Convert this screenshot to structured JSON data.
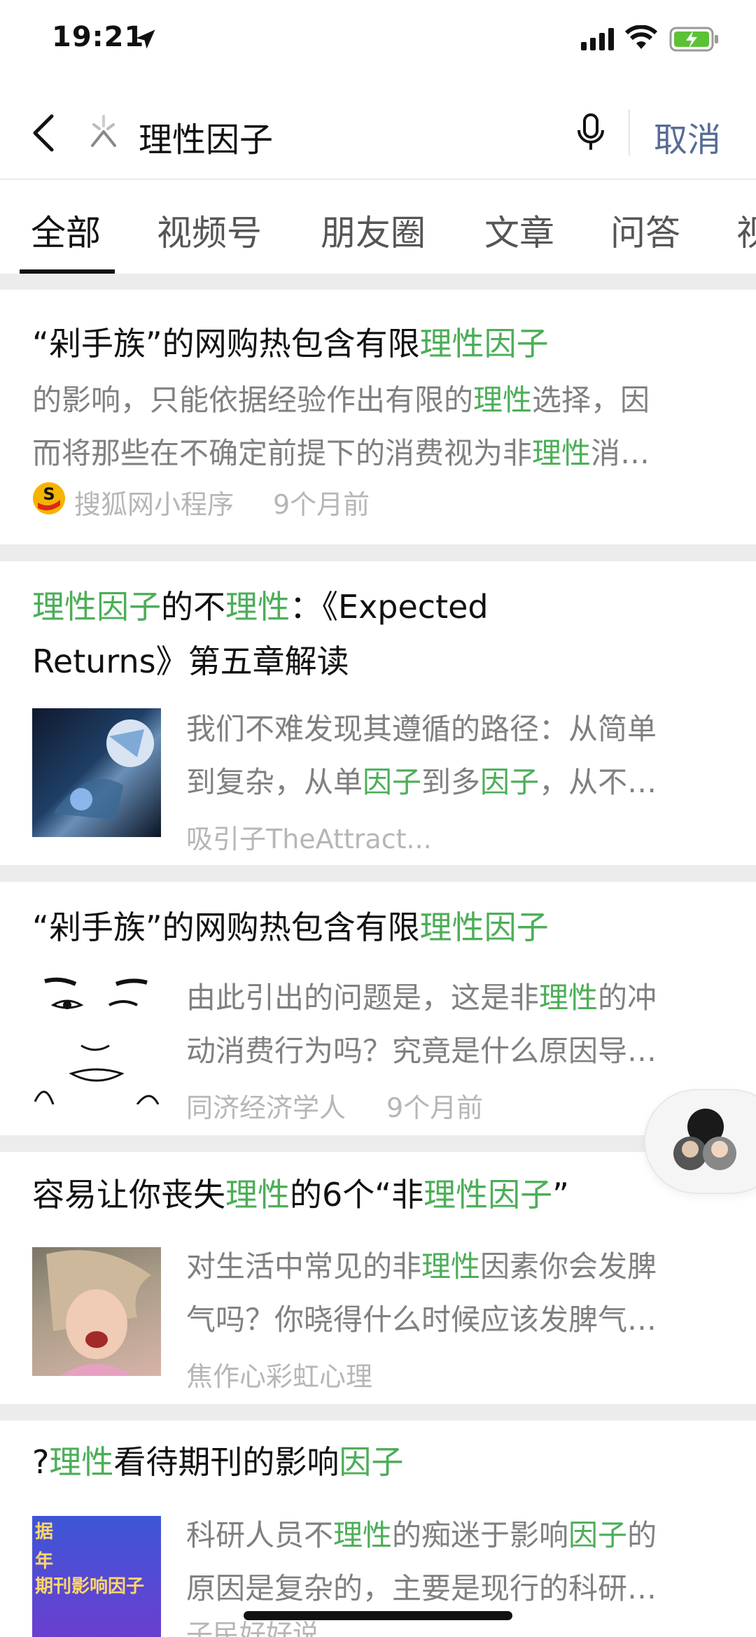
{
  "status": {
    "time": "19:21"
  },
  "search": {
    "query": "理性因子",
    "cancel_label": "取消"
  },
  "tabs": [
    "全部",
    "视频号",
    "朋友圈",
    "文章",
    "问答",
    "视"
  ],
  "results": [
    {
      "title_parts": [
        "“剁手族”的网购热包含有限",
        "理性因子"
      ],
      "snippet_line1": [
        "的影响，只能依据经验作出有限的",
        "理性",
        "选择，因"
      ],
      "snippet_line2": [
        "而将那些在不确定前提下的消费视为非",
        "理性",
        "消…"
      ],
      "source": "搜狐网小程序",
      "time": "9个月前"
    },
    {
      "title_parts": [
        "理性因子",
        "的不",
        "理性",
        "：《Expected"
      ],
      "title_line2": "Returns》第五章解读",
      "snippet_line1": "我们不难发现其遵循的路径：从简单",
      "snippet_line2": [
        "到复杂，从单",
        "因子",
        "到多",
        "因子",
        "，从不…"
      ],
      "source": "吸引子TheAttract..."
    },
    {
      "title_parts": [
        "“剁手族”的网购热包含有限",
        "理性因子"
      ],
      "snippet_line1": [
        "由此引出的问题是，这是非",
        "理性",
        "的冲"
      ],
      "snippet_line2": "动消费行为吗？究竟是什么原因导…",
      "source": "同济经济学人",
      "time": "9个月前"
    },
    {
      "title_parts": [
        "容易让你丧失",
        "理性",
        "的6个“非",
        "理性因子",
        "”"
      ],
      "snippet_line1": [
        "对生活中常见的非",
        "理性",
        "因素你会发脾"
      ],
      "snippet_line2": "气吗？你晓得什么时候应该发脾气…",
      "source": "焦作心彩虹心理"
    },
    {
      "title_parts": [
        "?",
        "理性",
        "看待期刊的影响",
        "因子"
      ],
      "snippet_line1": [
        "科研人员不",
        "理性",
        "的痴迷于影响",
        "因子",
        "的"
      ],
      "snippet_line2": "原因是复杂的，主要是现行的科研…",
      "source": "子民好好说",
      "thumb_text": [
        "据",
        "年",
        "期刊影响因子"
      ]
    }
  ],
  "colors": {
    "highlight": "#4cae58",
    "link": "#576b95",
    "background": "#ececec"
  }
}
